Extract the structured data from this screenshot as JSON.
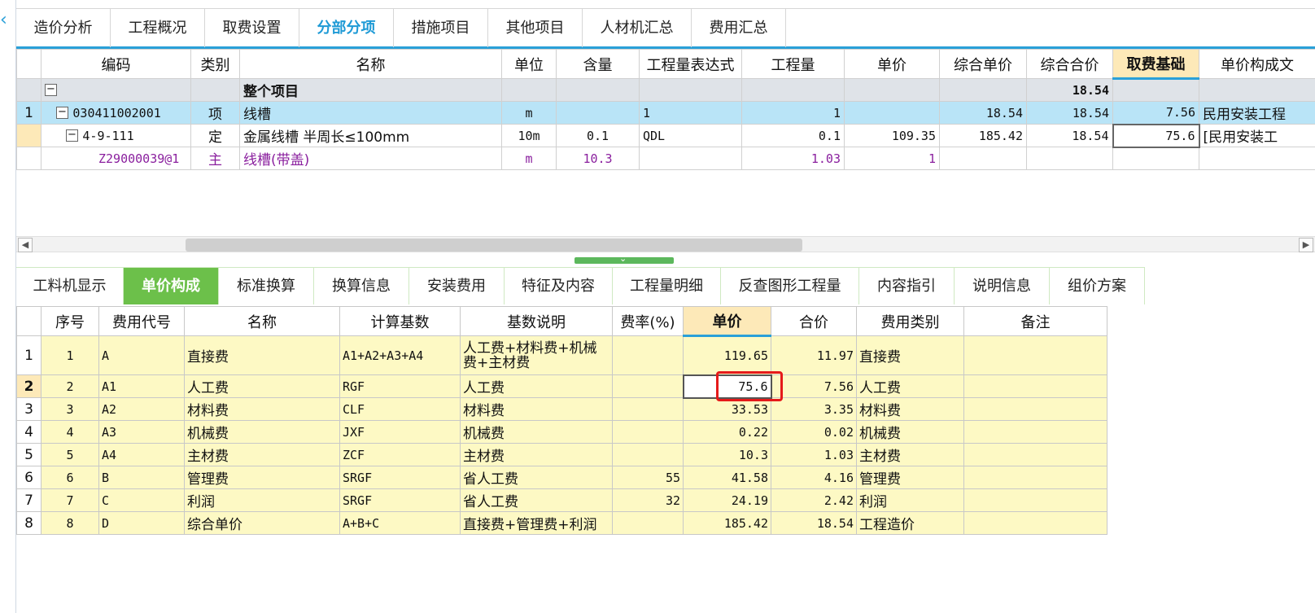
{
  "top_tabs": [
    {
      "label": "造价分析"
    },
    {
      "label": "工程概况"
    },
    {
      "label": "取费设置"
    },
    {
      "label": "分部分项"
    },
    {
      "label": "措施项目"
    },
    {
      "label": "其他项目"
    },
    {
      "label": "人材机汇总"
    },
    {
      "label": "费用汇总"
    }
  ],
  "upper": {
    "columns": [
      "编码",
      "类别",
      "名称",
      "单位",
      "含量",
      "工程量表达式",
      "工程量",
      "单价",
      "综合单价",
      "综合合价",
      "取费基础",
      "单价构成文"
    ],
    "project_row": {
      "name": "整个项目",
      "total": "18.54"
    },
    "rows": [
      {
        "num": "1",
        "code": "030411002001",
        "type": "项",
        "name": "线槽",
        "unit": "m",
        "content": "",
        "expr": "1",
        "qty": "1",
        "price": "",
        "unit_price": "18.54",
        "total": "18.54",
        "base": "7.56",
        "compose": "民用安装工程"
      },
      {
        "num": "",
        "code": "4-9-111",
        "type": "定",
        "name": "金属线槽 半周长≤100mm",
        "unit": "10m",
        "content": "0.1",
        "expr": "QDL",
        "qty": "0.1",
        "price": "109.35",
        "unit_price": "185.42",
        "total": "18.54",
        "base": "75.6",
        "compose": "[民用安装工"
      },
      {
        "num": "",
        "code": "Z29000039@1",
        "type": "主",
        "name": "线槽(带盖)",
        "unit": "m",
        "content": "10.3",
        "expr": "",
        "qty": "1.03",
        "price": "1",
        "unit_price": "",
        "total": "",
        "base": "",
        "compose": ""
      }
    ]
  },
  "bottom_tabs": [
    {
      "label": "工料机显示"
    },
    {
      "label": "单价构成"
    },
    {
      "label": "标准换算"
    },
    {
      "label": "换算信息"
    },
    {
      "label": "安装费用"
    },
    {
      "label": "特征及内容"
    },
    {
      "label": "工程量明细"
    },
    {
      "label": "反查图形工程量"
    },
    {
      "label": "内容指引"
    },
    {
      "label": "说明信息"
    },
    {
      "label": "组价方案"
    }
  ],
  "lower": {
    "columns": [
      "序号",
      "费用代号",
      "名称",
      "计算基数",
      "基数说明",
      "费率(%)",
      "单价",
      "合价",
      "费用类别",
      "备注"
    ],
    "rows": [
      {
        "rn": "1",
        "seq": "1",
        "code": "A",
        "name": "直接费",
        "base": "A1+A2+A3+A4",
        "desc": "人工费+材料费+机械费+主材费",
        "rate": "",
        "price": "119.65",
        "total": "11.97",
        "category": "直接费",
        "note": ""
      },
      {
        "rn": "2",
        "seq": "2",
        "code": "A1",
        "name": "人工费",
        "base": "RGF",
        "desc": "人工费",
        "rate": "",
        "price": "75.6",
        "total": "7.56",
        "category": "人工费",
        "note": ""
      },
      {
        "rn": "3",
        "seq": "3",
        "code": "A2",
        "name": "材料费",
        "base": "CLF",
        "desc": "材料费",
        "rate": "",
        "price": "33.53",
        "total": "3.35",
        "category": "材料费",
        "note": ""
      },
      {
        "rn": "4",
        "seq": "4",
        "code": "A3",
        "name": "机械费",
        "base": "JXF",
        "desc": "机械费",
        "rate": "",
        "price": "0.22",
        "total": "0.02",
        "category": "机械费",
        "note": ""
      },
      {
        "rn": "5",
        "seq": "5",
        "code": "A4",
        "name": "主材费",
        "base": "ZCF",
        "desc": "主材费",
        "rate": "",
        "price": "10.3",
        "total": "1.03",
        "category": "主材费",
        "note": ""
      },
      {
        "rn": "6",
        "seq": "6",
        "code": "B",
        "name": "管理费",
        "base": "SRGF",
        "desc": "省人工费",
        "rate": "55",
        "price": "41.58",
        "total": "4.16",
        "category": "管理费",
        "note": ""
      },
      {
        "rn": "7",
        "seq": "7",
        "code": "C",
        "name": "利润",
        "base": "SRGF",
        "desc": "省人工费",
        "rate": "32",
        "price": "24.19",
        "total": "2.42",
        "category": "利润",
        "note": ""
      },
      {
        "rn": "8",
        "seq": "8",
        "code": "D",
        "name": "综合单价",
        "base": "A+B+C",
        "desc": "直接费+管理费+利润",
        "rate": "",
        "price": "185.42",
        "total": "18.54",
        "category": "工程造价",
        "note": ""
      }
    ]
  },
  "icons": {
    "collapse": "chevron-left-icon",
    "tree_collapse": "minus-box-icon",
    "scroll_left": "triangle-left-icon",
    "scroll_right": "triangle-right-icon"
  },
  "colors": {
    "accent": "#2aa0d8",
    "active_tab_green": "#6cc04a",
    "highlight_header": "#fde9b8",
    "selected_row": "#b9e4f7",
    "grid_yellow": "#fdf9c4",
    "focus_box_red": "#e51a1a"
  }
}
